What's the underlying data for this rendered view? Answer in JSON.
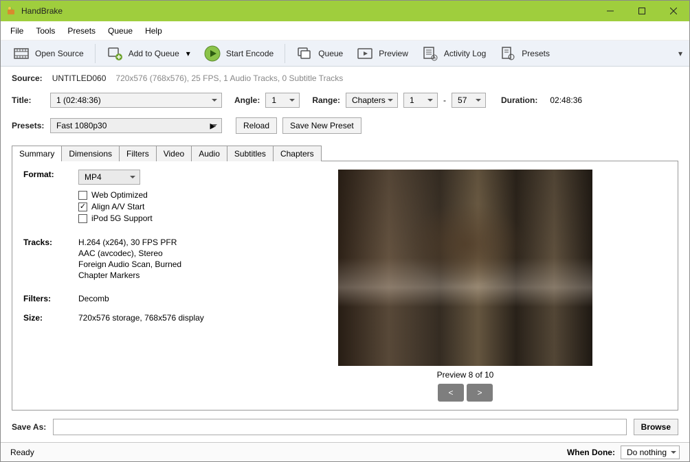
{
  "window": {
    "title": "HandBrake"
  },
  "menu": {
    "file": "File",
    "tools": "Tools",
    "presets": "Presets",
    "queue": "Queue",
    "help": "Help"
  },
  "toolbar": {
    "open_source": "Open Source",
    "add_to_queue": "Add to Queue",
    "start_encode": "Start Encode",
    "queue": "Queue",
    "preview": "Preview",
    "activity_log": "Activity Log",
    "presets": "Presets"
  },
  "source": {
    "label": "Source:",
    "name": "UNTITLED060",
    "meta": "720x576 (768x576), 25 FPS, 1 Audio Tracks, 0 Subtitle Tracks"
  },
  "title_row": {
    "title_label": "Title:",
    "title_value": "1 (02:48:36)",
    "angle_label": "Angle:",
    "angle_value": "1",
    "range_label": "Range:",
    "range_type": "Chapters",
    "range_from": "1",
    "range_dash": "-",
    "range_to": "57",
    "duration_label": "Duration:",
    "duration_value": "02:48:36"
  },
  "presets_row": {
    "label": "Presets:",
    "value": "Fast 1080p30",
    "reload": "Reload",
    "save_new": "Save New Preset"
  },
  "tabs": {
    "summary": "Summary",
    "dimensions": "Dimensions",
    "filters": "Filters",
    "video": "Video",
    "audio": "Audio",
    "subtitles": "Subtitles",
    "chapters": "Chapters"
  },
  "summary": {
    "format_label": "Format:",
    "format_value": "MP4",
    "web_optimized": "Web Optimized",
    "align_av": "Align A/V Start",
    "ipod": "iPod 5G Support",
    "tracks_label": "Tracks:",
    "tracks": [
      "H.264 (x264), 30 FPS PFR",
      "AAC (avcodec), Stereo",
      "Foreign Audio Scan, Burned",
      "Chapter Markers"
    ],
    "filters_label": "Filters:",
    "filters_value": "Decomb",
    "size_label": "Size:",
    "size_value": "720x576 storage, 768x576 display"
  },
  "preview": {
    "caption": "Preview 8 of 10",
    "prev": "<",
    "next": ">"
  },
  "saveas": {
    "label": "Save As:",
    "value": "",
    "browse": "Browse"
  },
  "status": {
    "ready": "Ready",
    "when_done_label": "When Done:",
    "when_done_value": "Do nothing"
  }
}
